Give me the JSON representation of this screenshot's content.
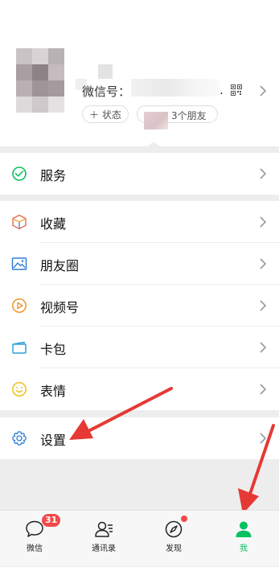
{
  "colors": {
    "accent": "#07c160",
    "badge": "#f44848",
    "background": "#ededed",
    "annotation_arrow": "#e53935"
  },
  "profile": {
    "wechat_id_label": "微信号：",
    "wechat_id_trailing": ".",
    "status_button": "＋ 状态",
    "friends_text": "3个朋友"
  },
  "menu": {
    "service": {
      "label": "服务",
      "icon": "wallet-check-icon"
    },
    "items": [
      {
        "label": "收藏",
        "icon": "cube-icon"
      },
      {
        "label": "朋友圈",
        "icon": "image-icon"
      },
      {
        "label": "视频号",
        "icon": "play-circle-icon"
      },
      {
        "label": "卡包",
        "icon": "card-icon"
      },
      {
        "label": "表情",
        "icon": "smile-icon"
      }
    ],
    "settings": {
      "label": "设置",
      "icon": "gear-icon"
    }
  },
  "tabbar": {
    "tabs": [
      {
        "label": "微信",
        "icon": "chat-bubble-icon",
        "badge": "31"
      },
      {
        "label": "通讯录",
        "icon": "contacts-icon"
      },
      {
        "label": "发现",
        "icon": "compass-icon",
        "dot": true
      },
      {
        "label": "我",
        "icon": "person-icon",
        "active": true
      }
    ]
  }
}
